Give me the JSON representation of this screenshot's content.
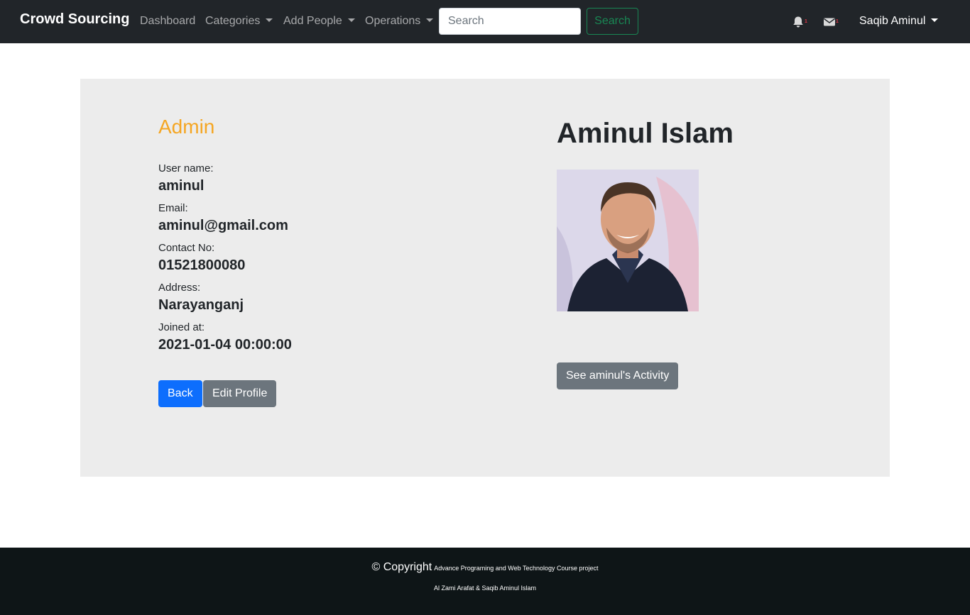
{
  "navbar": {
    "brand": "Crowd Sourcing",
    "links": [
      {
        "label": "Dashboard"
      },
      {
        "label": "Categories"
      },
      {
        "label": "Add People"
      },
      {
        "label": "Operations"
      }
    ],
    "search": {
      "placeholder": "Search",
      "button_label": "Search"
    },
    "notifications": {
      "icon": "bell-icon",
      "count": "1"
    },
    "messages": {
      "icon": "envelope-icon",
      "count": "1"
    },
    "user": "Saqib Aminul"
  },
  "profile": {
    "role": "Admin",
    "fields": [
      {
        "label": "User name:",
        "value": "aminul"
      },
      {
        "label": "Email:",
        "value": "aminul@gmail.com"
      },
      {
        "label": "Contact No:",
        "value": "01521800080"
      },
      {
        "label": "Address:",
        "value": "Narayanganj"
      },
      {
        "label": "Joined at:",
        "value": "2021-01-04 00:00:00"
      }
    ],
    "back_label": "Back",
    "edit_label": "Edit Profile",
    "full_name": "Aminul Islam",
    "activity_label": "See aminul's Activity"
  },
  "footer": {
    "copyright": "© Copyright",
    "project": "Advance Programing and Web Technology Course project",
    "authors": "Al Zami Arafat & Saqib Aminul Islam"
  },
  "colors": {
    "navbar_bg": "#212529",
    "role_accent": "#f5a623",
    "primary": "#0d6efd",
    "secondary": "#6c757d",
    "success": "#198754",
    "footer_bg": "#0e1517"
  }
}
